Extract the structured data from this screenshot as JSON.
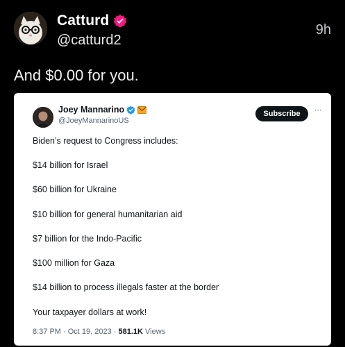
{
  "author": {
    "display_name": "Catturd",
    "handle": "@catturd2",
    "time": "9h",
    "badge_color": "#f91880",
    "avatar_icon": "cat-with-glasses-avatar"
  },
  "tweet": {
    "text": "And $0.00 for you."
  },
  "quoted": {
    "display_name": "Joey Mannarino",
    "handle": "@JoeyMannarinoUS",
    "verified_color": "#1d9bf0",
    "emoji_icon": "envelope-emoji-icon",
    "subscribe_label": "Subscribe",
    "more_label": "···",
    "lines": [
      "Biden’s request to Congress includes:",
      "$14 billion for Israel",
      "$60 billion for Ukraine",
      "$10 billion for general humanitarian aid",
      "$7 billion for the Indo-Pacific",
      "$100 million for Gaza",
      "$14 billion to process illegals faster at the border",
      "Your taxpayer dollars at work!"
    ],
    "meta": {
      "date": "8:37 PM · Oct 19, 2023 · ",
      "views_count": "581.1K",
      "views_label": " Views"
    }
  }
}
